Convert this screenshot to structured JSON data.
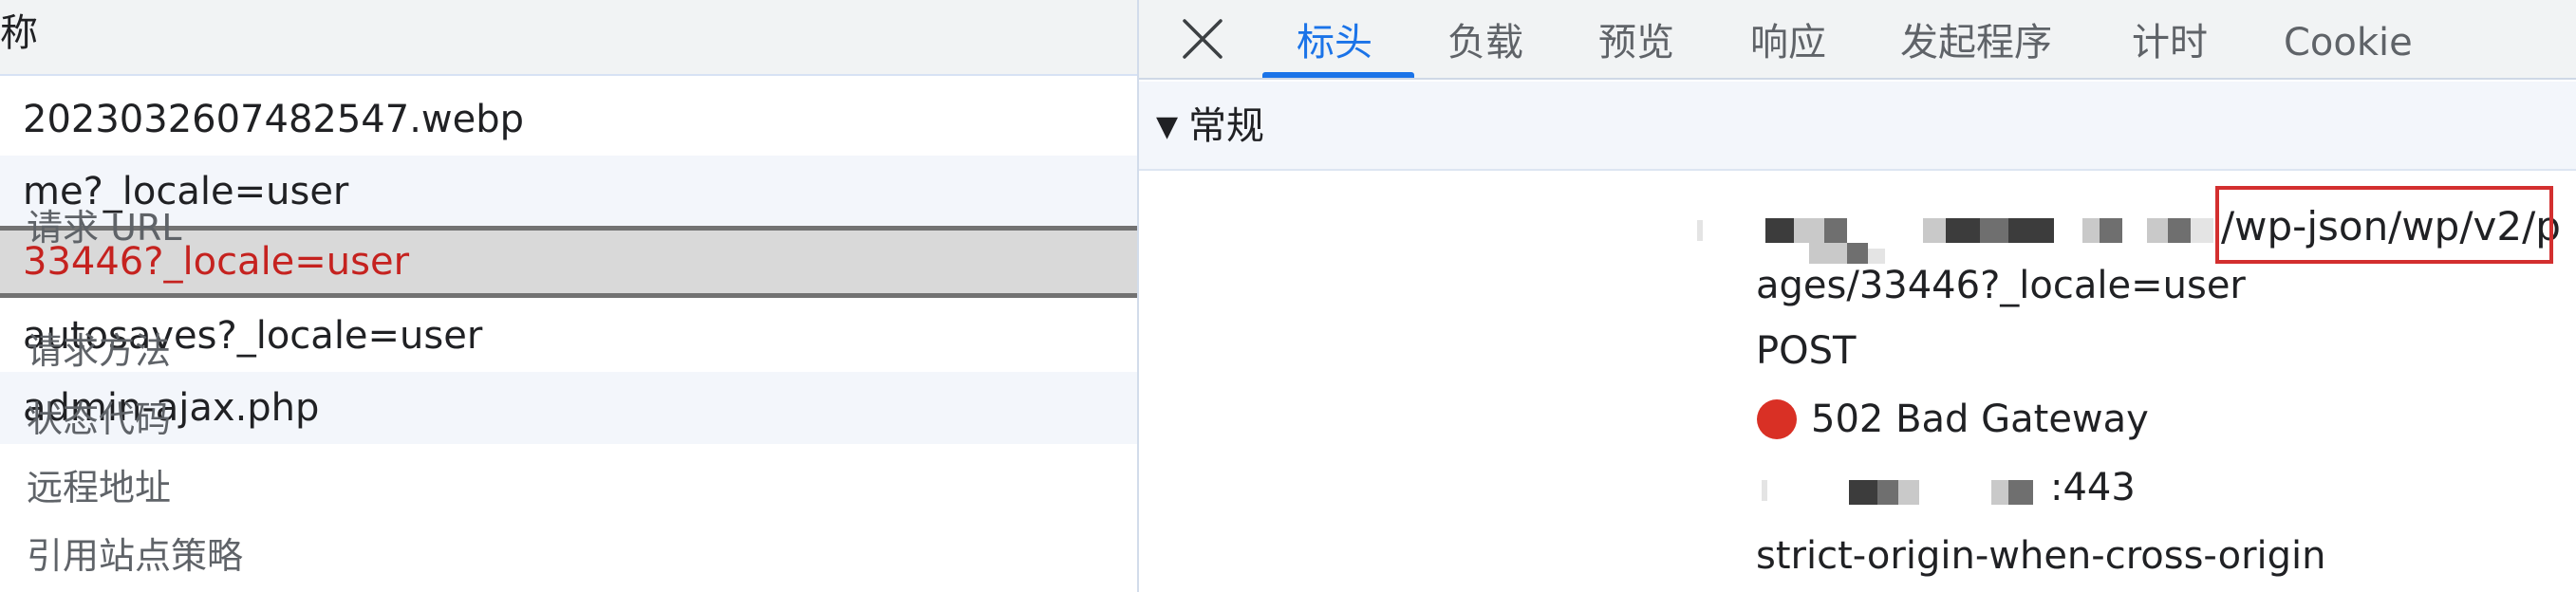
{
  "list": {
    "header": "称",
    "rows": [
      "2023032607482547.webp",
      "me?_locale=user",
      "33446?_locale=user",
      "autosaves?_locale=user",
      "admin-ajax.php"
    ]
  },
  "details": {
    "tabs": [
      "标头",
      "负载",
      "预览",
      "响应",
      "发起程序",
      "计时",
      "Cookie"
    ],
    "active_tab": "标头",
    "section_title": "常规",
    "fields": {
      "request_url_label": "请求 URL",
      "request_url_value_line1": "/wp-json/wp/v2/p",
      "request_url_value_line2": "ages/33446?_locale=user",
      "request_method_label": "请求方法",
      "request_method_value": "POST",
      "status_code_label": "状态代码",
      "status_code_value": "502 Bad Gateway",
      "remote_address_label": "远程地址",
      "remote_address_value": ":443",
      "referrer_policy_label": "引用站点策略",
      "referrer_policy_value": "strict-origin-when-cross-origin"
    }
  },
  "colors": {
    "accent": "#1a73e8",
    "error": "#d93025",
    "selected_text": "#c5221f",
    "highlight_box": "#d32f2f"
  }
}
